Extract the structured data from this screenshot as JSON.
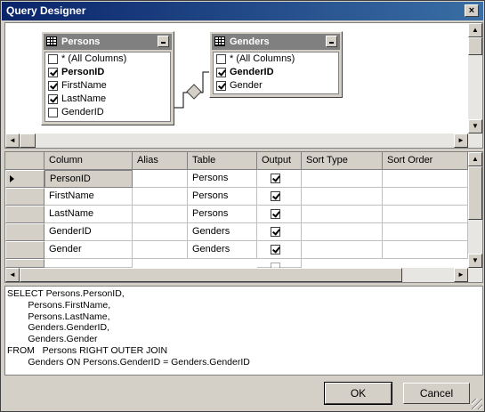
{
  "window": {
    "title": "Query Designer",
    "close_glyph": "×"
  },
  "diagram": {
    "tables": [
      {
        "name": "Persons",
        "columns": [
          {
            "label": "* (All Columns)",
            "checked": false,
            "bold": false
          },
          {
            "label": "PersonID",
            "checked": true,
            "bold": true
          },
          {
            "label": "FirstName",
            "checked": true,
            "bold": false
          },
          {
            "label": "LastName",
            "checked": true,
            "bold": false
          },
          {
            "label": "GenderID",
            "checked": false,
            "bold": false
          }
        ]
      },
      {
        "name": "Genders",
        "columns": [
          {
            "label": "* (All Columns)",
            "checked": false,
            "bold": false
          },
          {
            "label": "GenderID",
            "checked": true,
            "bold": true
          },
          {
            "label": "Gender",
            "checked": true,
            "bold": false
          }
        ]
      }
    ]
  },
  "grid": {
    "headers": [
      "Column",
      "Alias",
      "Table",
      "Output",
      "Sort Type",
      "Sort Order"
    ],
    "rows": [
      {
        "column": "PersonID",
        "alias": "",
        "table": "Persons",
        "output": true,
        "sort_type": "",
        "sort_order": ""
      },
      {
        "column": "FirstName",
        "alias": "",
        "table": "Persons",
        "output": true,
        "sort_type": "",
        "sort_order": ""
      },
      {
        "column": "LastName",
        "alias": "",
        "table": "Persons",
        "output": true,
        "sort_type": "",
        "sort_order": ""
      },
      {
        "column": "GenderID",
        "alias": "",
        "table": "Genders",
        "output": true,
        "sort_type": "",
        "sort_order": ""
      },
      {
        "column": "Gender",
        "alias": "",
        "table": "Genders",
        "output": true,
        "sort_type": "",
        "sort_order": ""
      }
    ]
  },
  "sql": {
    "lines": [
      "SELECT Persons.PersonID,",
      "        Persons.FirstName,",
      "        Persons.LastName,",
      "        Genders.GenderID,",
      "        Genders.Gender",
      "FROM   Persons RIGHT OUTER JOIN",
      "        Genders ON Persons.GenderID = Genders.GenderID"
    ]
  },
  "buttons": {
    "ok": "OK",
    "cancel": "Cancel"
  },
  "icons": {
    "table": "table-grid-icon",
    "minimize": "minimize-icon",
    "join": "join-diamond-icon",
    "checkbox": "checkbox-icon",
    "row_pointer": "row-pointer-icon",
    "scroll_left": "◄",
    "scroll_right": "►",
    "scroll_up": "▲",
    "scroll_down": "▼"
  }
}
